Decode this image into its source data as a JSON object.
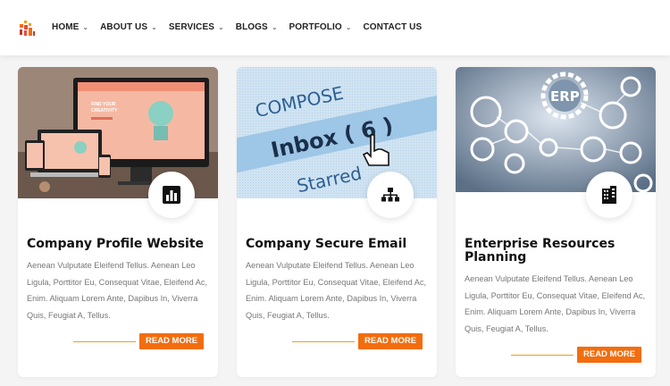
{
  "nav": {
    "items": [
      {
        "label": "HOME",
        "dropdown": true
      },
      {
        "label": "ABOUT US",
        "dropdown": true
      },
      {
        "label": "SERVICES",
        "dropdown": true
      },
      {
        "label": "BLOGS",
        "dropdown": true
      },
      {
        "label": "PORTFOLIO",
        "dropdown": true
      },
      {
        "label": "CONTACT US",
        "dropdown": false
      }
    ]
  },
  "cards": [
    {
      "title": "Company Profile Website",
      "description": "Aenean Vulputate Eleifend Tellus. Aenean Leo Ligula, Porttitor Eu, Consequat Vitae, Eleifend Ac, Enim. Aliquam Lorem Ante, Dapibus In, Viverra Quis, Feugiat A, Tellus.",
      "button": "READ MORE",
      "icon": "bar-chart-icon",
      "image_text": [
        "FIND YOUR",
        "CREATIVITY"
      ]
    },
    {
      "title": "Company Secure Email",
      "description": "Aenean Vulputate Eleifend Tellus. Aenean Leo Ligula, Porttitor Eu, Consequat Vitae, Eleifend Ac, Enim. Aliquam Lorem Ante, Dapibus In, Viverra Quis, Feugiat A, Tellus.",
      "button": "READ MORE",
      "icon": "sitemap-icon",
      "image_text": [
        "COMPOSE",
        "Inbox ( 6 )",
        "Starred"
      ]
    },
    {
      "title": "Enterprise Resources Planning",
      "description": "Aenean Vulputate Eleifend Tellus. Aenean Leo Ligula, Porttitor Eu, Consequat Vitae, Eleifend Ac, Enim. Aliquam Lorem Ante, Dapibus In, Viverra Quis, Feugiat A, Tellus.",
      "button": "READ MORE",
      "icon": "building-icon",
      "image_text": [
        "ERP"
      ]
    }
  ],
  "colors": {
    "accent": "#f26d0e",
    "accent_line": "#f39c12",
    "title": "#111111",
    "text": "#777777"
  }
}
